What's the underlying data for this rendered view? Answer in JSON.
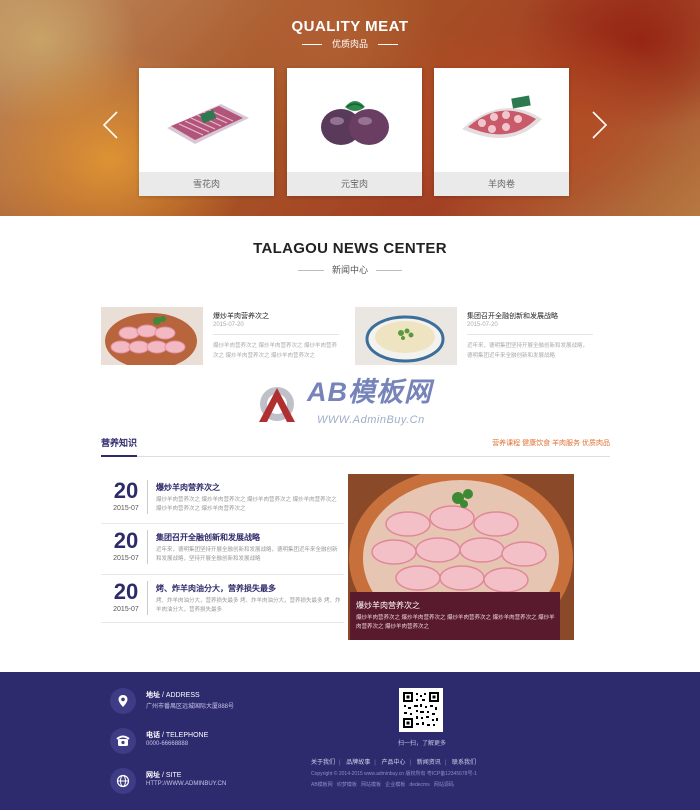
{
  "hero": {
    "title": "QUALITY MEAT",
    "subtitle": "优质肉品",
    "products": [
      {
        "label": "雪花肉"
      },
      {
        "label": "元宝肉"
      },
      {
        "label": "羊肉卷"
      }
    ]
  },
  "news": {
    "title": "TALAGOU NEWS CENTER",
    "subtitle": "新闻中心",
    "items": [
      {
        "title": "爆炒羊肉营养次之",
        "date": "2015-07-20",
        "excerpt": "爆炒羊肉营养次之 爆炒羊肉营养次之 爆炒羊肉营养次之 爆炒羊肉营养次之 爆炒羊肉营养次之"
      },
      {
        "title": "集团召开全融创新和发展战略",
        "date": "2015-07-20",
        "excerpt": "近年来，德明集团坚持开展全融创新和发展战略，德明集团近年来全融创新和发展战略"
      }
    ]
  },
  "watermark": {
    "text": "AB模板网",
    "url": "WWW.AdminBuy.Cn"
  },
  "nutrition": {
    "label": "营养知识",
    "tags": "营养课程 健康饮食 羊肉服务 优质肉品",
    "items": [
      {
        "day": "20",
        "ym": "2015-07",
        "title": "爆炒羊肉营养次之",
        "excerpt": "爆炒羊肉营养次之 爆炒羊肉营养次之 爆炒羊肉营养次之 爆炒羊肉营养次之 爆炒羊肉营养次之 爆炒羊肉营养次之"
      },
      {
        "day": "20",
        "ym": "2015-07",
        "title": "集团召开全融创新和发展战略",
        "excerpt": "近年来，德明集团坚持开展全融创新和发展战略，德明集团近年来全融创新和发展战略，坚持开展全融创新和发展战略"
      },
      {
        "day": "20",
        "ym": "2015-07",
        "title": "烤、炸羊肉油分大，营养损失最多",
        "excerpt": "烤、炸羊肉油分大，营养损失最多 烤、炸羊肉油分大，营养损失最多 烤、炸羊肉油分大，营养损失最多"
      }
    ],
    "featured": {
      "title": "爆炒羊肉营养次之",
      "excerpt": "爆炒羊肉营养次之 爆炒羊肉营养次之 爆炒羊肉营养次之 爆炒羊肉营养次之 爆炒羊肉营养次之 爆炒羊肉营养次之"
    }
  },
  "footer": {
    "address_label": "地址",
    "address_en": " / ADDRESS",
    "address_value": "广州市番禺区远城国际大厦888号",
    "phone_label": "电话",
    "phone_en": " / TELEPHONE",
    "phone_value": "0000-66668888",
    "site_label": "网址",
    "site_en": " / SITE",
    "site_value": "HTTP://WWW.ADMINBUY.CN",
    "qr_caption": "扫一扫，了解更多",
    "links": [
      "关于我们",
      "品牌故事",
      "产品中心",
      "新闻资讯",
      "联系我们"
    ],
    "copyright": "Copyright © 2014-2015 www.adminbuy.cn 版权所有 粤ICP备12345678号-1",
    "bottom_links": [
      "AB模板网",
      "织梦模板",
      "网站模板",
      "企业模板",
      "dedecms",
      "网站源码"
    ]
  },
  "colors": {
    "primary": "#2e2b6b",
    "accent": "#e07030",
    "footer_bg": "#2e2a6e"
  }
}
